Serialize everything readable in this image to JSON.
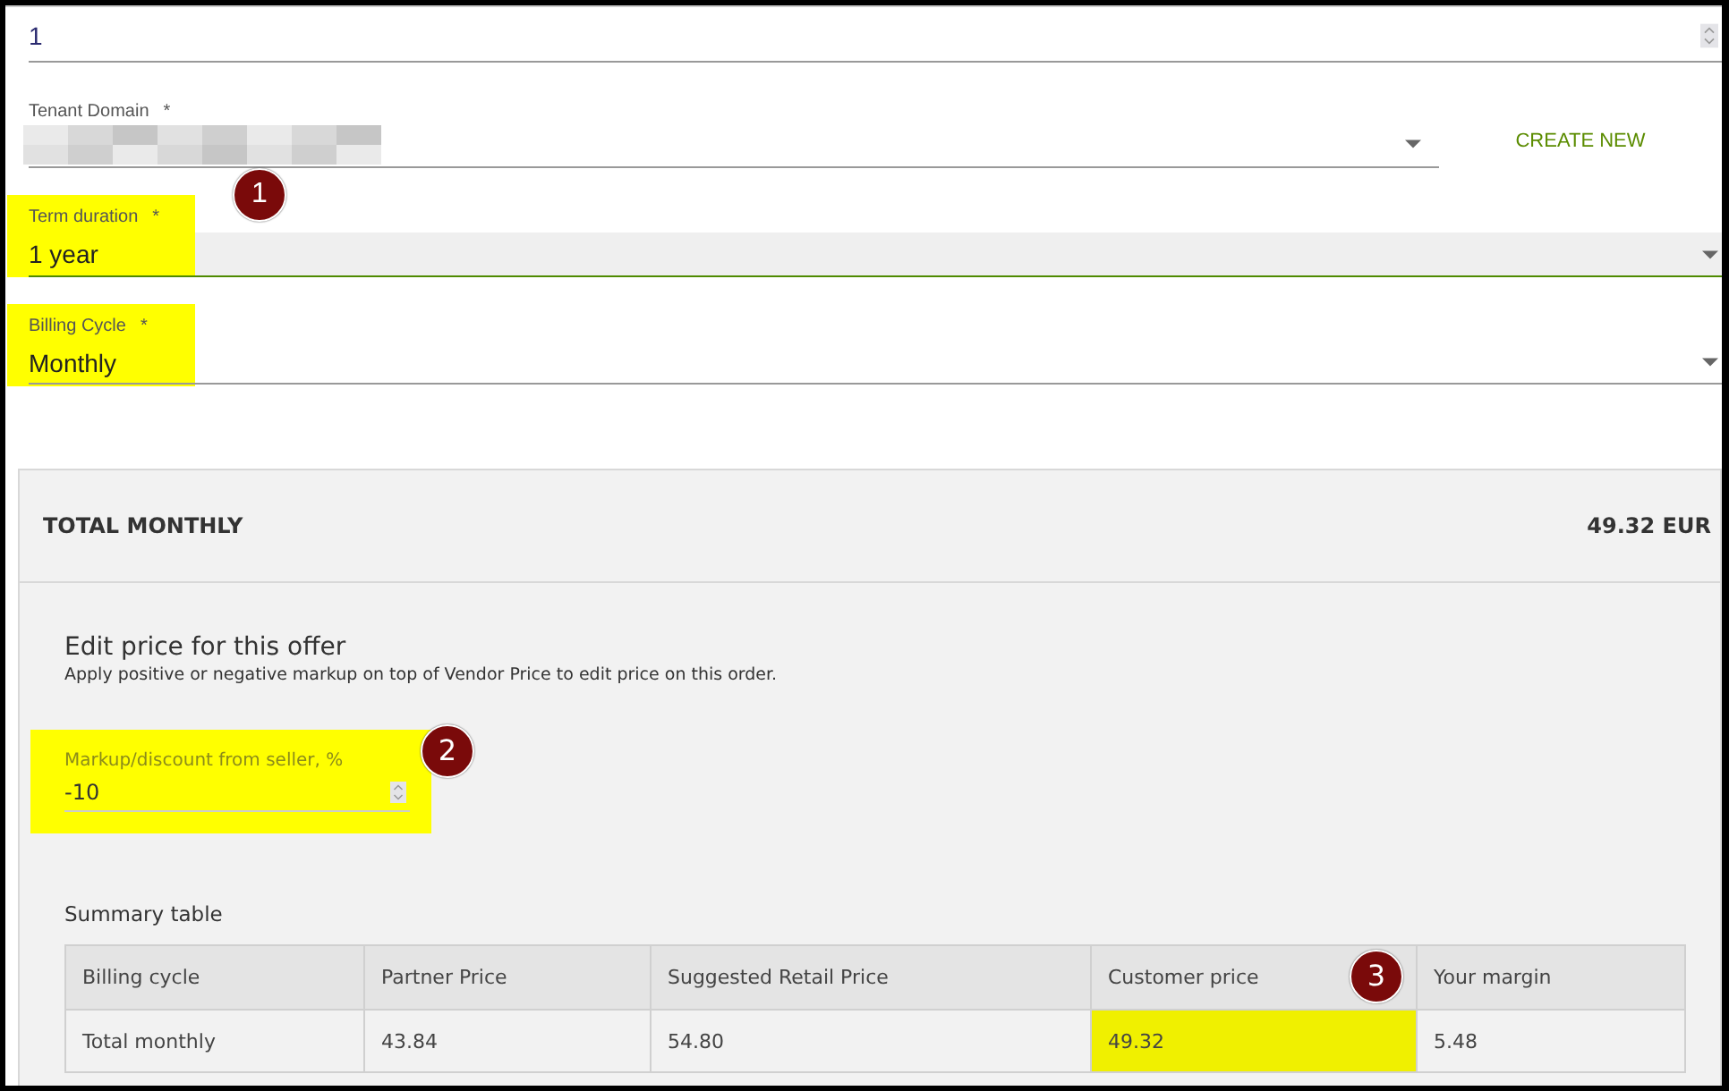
{
  "fields": [
    {
      "kind": "number",
      "value": "1"
    },
    {
      "kind": "select_action",
      "label": "Tenant Domain",
      "required_mark": "*",
      "redacted": true,
      "action": "CREATE NEW"
    },
    {
      "kind": "select",
      "label": "Term duration",
      "required_mark": "*",
      "value": "1 year",
      "focused": true,
      "highlighted": true,
      "marker": "1"
    },
    {
      "kind": "select",
      "label": "Billing Cycle",
      "required_mark": "*",
      "value": "Monthly",
      "focused": false,
      "highlighted": true
    }
  ],
  "total": {
    "title": "TOTAL MONTHLY",
    "amount": "49.32 EUR"
  },
  "price_editor": {
    "title": "Edit price for this offer",
    "description": "Apply positive or negative markup on top of Vendor Price to edit price on this order.",
    "markup": {
      "label": "Markup/discount from seller, %",
      "value": "-10",
      "highlighted": true,
      "marker": "2"
    }
  },
  "summary": {
    "title": "Summary table",
    "columns": [
      {
        "label": "Billing cycle"
      },
      {
        "label": "Partner Price"
      },
      {
        "label": "Suggested Retail Price"
      },
      {
        "label": "Customer price",
        "marker": "3"
      },
      {
        "label": "Your margin"
      }
    ],
    "rows": [
      {
        "cells": [
          {
            "text": "Total monthly",
            "highlighted": false
          },
          {
            "text": "43.84",
            "highlighted": false
          },
          {
            "text": "54.80",
            "highlighted": false
          },
          {
            "text": "49.32",
            "highlighted": true
          },
          {
            "text": "5.48",
            "highlighted": false
          }
        ]
      }
    ]
  }
}
